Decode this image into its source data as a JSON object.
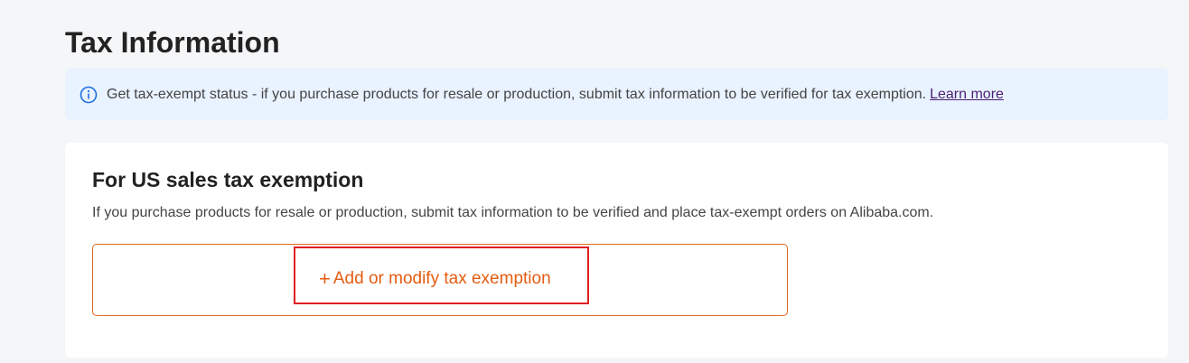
{
  "page": {
    "title": "Tax Information"
  },
  "notice": {
    "icon": "info-icon",
    "text": "Get tax-exempt status - if you purchase products for resale or production, submit tax information to be verified for tax exemption.",
    "link_label": "Learn more"
  },
  "us_exemption": {
    "title": "For US sales tax exemption",
    "description": "If you purchase products for resale or production, submit tax information to be verified and place tax-exempt orders on Alibaba.com.",
    "add_button": {
      "icon": "plus-icon",
      "icon_glyph": "+",
      "label": "Add or modify tax exemption"
    }
  },
  "colors": {
    "accent": "#e45c12",
    "notice_bg": "#e9f2ff",
    "link": "#4a1f74",
    "highlight": "#e02020"
  }
}
